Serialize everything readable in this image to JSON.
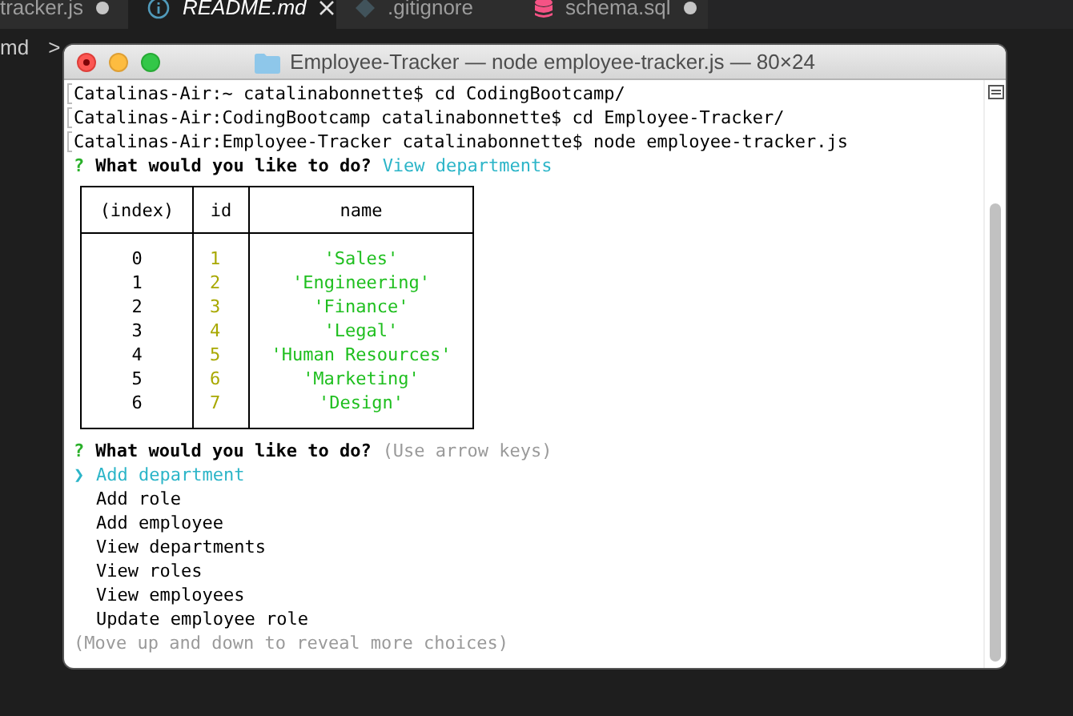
{
  "editor": {
    "tabs": [
      {
        "label": "tracker.js",
        "kind": "none",
        "selected": false,
        "modified": true
      },
      {
        "label": "README.md",
        "kind": "info",
        "selected": true,
        "modified": false
      },
      {
        "label": ".gitignore",
        "kind": "diamond",
        "selected": false,
        "modified": false
      },
      {
        "label": "schema.sql",
        "kind": "database",
        "selected": false,
        "modified": true
      }
    ],
    "breadcrumb": {
      "label": "md",
      "separator": ">"
    }
  },
  "terminal": {
    "title": "Employee-Tracker — node employee-tracker.js — 80×24",
    "history": [
      "Catalinas-Air:~ catalinabonnette$ cd CodingBootcamp/",
      "Catalinas-Air:CodingBootcamp catalinabonnette$ cd Employee-Tracker/",
      "Catalinas-Air:Employee-Tracker catalinabonnette$ node employee-tracker.js"
    ],
    "first_prompt": {
      "mark": "?",
      "question": "What would you like to do?",
      "answer": "View departments"
    },
    "table": {
      "columns": [
        "(index)",
        "id",
        "name"
      ],
      "rows": [
        [
          "0",
          "1",
          "'Sales'"
        ],
        [
          "1",
          "2",
          "'Engineering'"
        ],
        [
          "2",
          "3",
          "'Finance'"
        ],
        [
          "3",
          "4",
          "'Legal'"
        ],
        [
          "4",
          "5",
          "'Human Resources'"
        ],
        [
          "5",
          "6",
          "'Marketing'"
        ],
        [
          "6",
          "7",
          "'Design'"
        ]
      ]
    },
    "second_prompt": {
      "mark": "?",
      "question": "What would you like to do?",
      "hint": "(Use arrow keys)"
    },
    "pointer": "❯",
    "choices": [
      {
        "label": "Add department",
        "selected": true
      },
      {
        "label": "Add role",
        "selected": false
      },
      {
        "label": "Add employee",
        "selected": false
      },
      {
        "label": "View departments",
        "selected": false
      },
      {
        "label": "View roles",
        "selected": false
      },
      {
        "label": "View employees",
        "selected": false
      },
      {
        "label": "Update employee role",
        "selected": false
      }
    ],
    "footer": "(Move up and down to reveal more choices)"
  }
}
